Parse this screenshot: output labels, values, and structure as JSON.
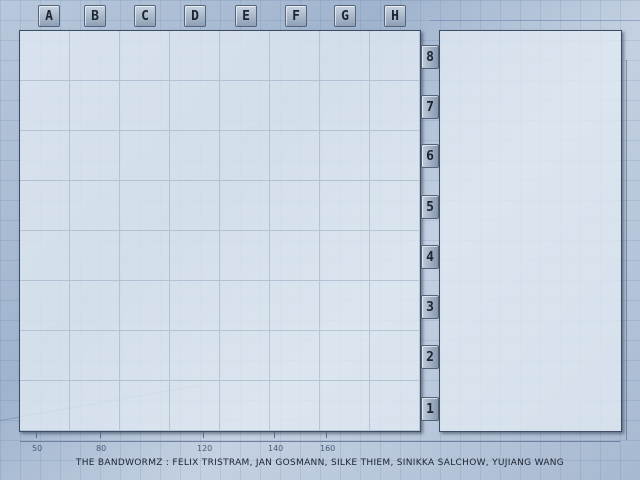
{
  "columns": [
    "A",
    "B",
    "C",
    "D",
    "E",
    "F",
    "G",
    "H"
  ],
  "rows": [
    "8",
    "7",
    "6",
    "5",
    "4",
    "3",
    "2",
    "1"
  ],
  "ruler": [
    "50",
    "80",
    "120",
    "140",
    "160"
  ],
  "credits": "THE BANDWORMZ : FELIX TRISTRAM, JAN GOSMANN, SILKE THIEM, SINIKKA SALCHOW, YUJIANG WANG",
  "colors": {
    "panel": "#e2eaf4",
    "label_button": "#aab8ca",
    "border": "#3e4d66"
  }
}
